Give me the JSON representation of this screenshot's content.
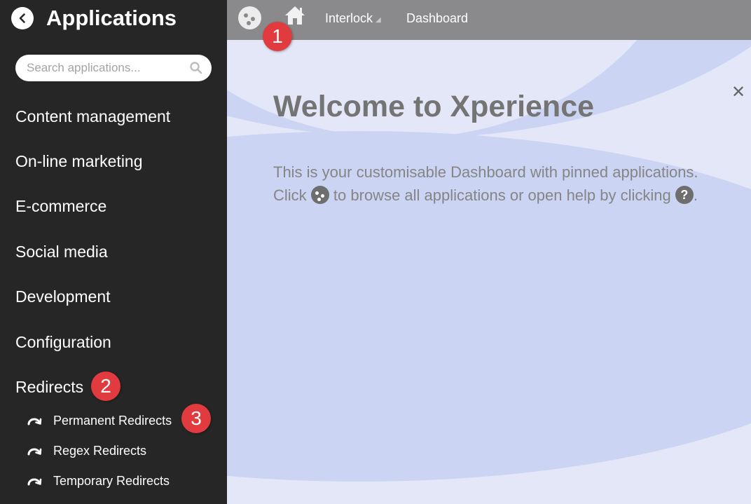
{
  "sidebar": {
    "title": "Applications",
    "search_placeholder": "Search applications...",
    "categories": [
      {
        "label": "Content management"
      },
      {
        "label": "On-line marketing"
      },
      {
        "label": "E-commerce"
      },
      {
        "label": "Social media"
      },
      {
        "label": "Development"
      },
      {
        "label": "Configuration"
      },
      {
        "label": "Redirects"
      }
    ],
    "redirect_items": [
      {
        "label": "Permanent Redirects"
      },
      {
        "label": "Regex Redirects"
      },
      {
        "label": "Temporary Redirects"
      }
    ]
  },
  "topbar": {
    "site": "Interlock",
    "page": "Dashboard"
  },
  "main": {
    "title": "Welcome to Xperience",
    "line1": "This is your customisable Dashboard with pinned applications.",
    "line2_a": "Click",
    "line2_b": "to browse all applications or open help by clicking",
    "line2_c": "."
  },
  "markers": [
    "1",
    "2",
    "3"
  ],
  "colors": {
    "sidebar_bg": "#262626",
    "topbar_bg": "#8a8a8c",
    "main_bg": "#e3e7f7",
    "blob": "#cbd4f3",
    "marker": "#e23b3f"
  }
}
